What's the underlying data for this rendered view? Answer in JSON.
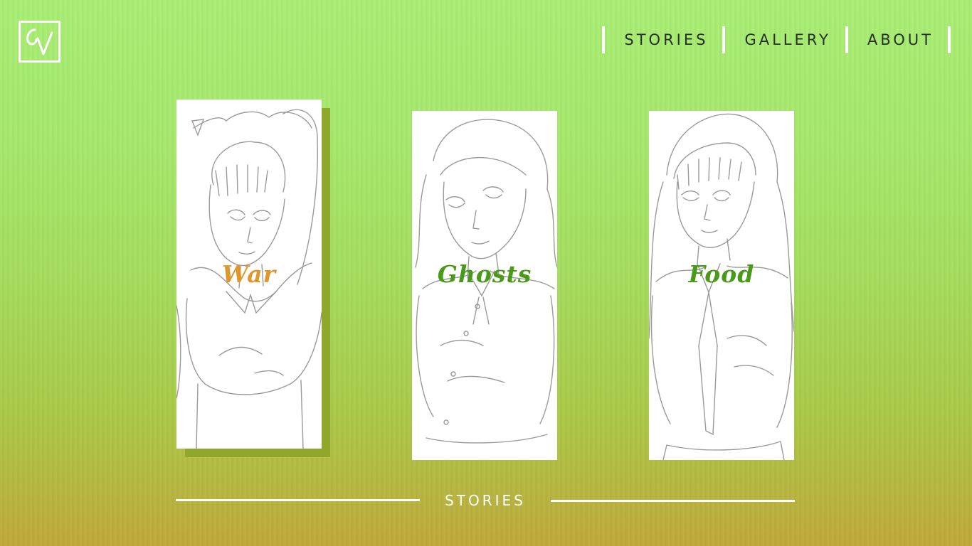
{
  "logo": {
    "text": "CV"
  },
  "nav": {
    "items": [
      {
        "label": "STORIES"
      },
      {
        "label": "GALLERY"
      },
      {
        "label": "ABOUT"
      }
    ]
  },
  "cards": [
    {
      "label": "War",
      "color": "#e0962a"
    },
    {
      "label": "Ghosts",
      "color": "#4a9a1a"
    },
    {
      "label": "Food",
      "color": "#4a9a1a"
    }
  ],
  "footer": {
    "label": "STORIES"
  },
  "colors": {
    "background_top": "#a8ee74",
    "background_bottom": "#c0a83a",
    "card_shadow": "#8fa82c",
    "nav_text": "#2a2f28"
  }
}
